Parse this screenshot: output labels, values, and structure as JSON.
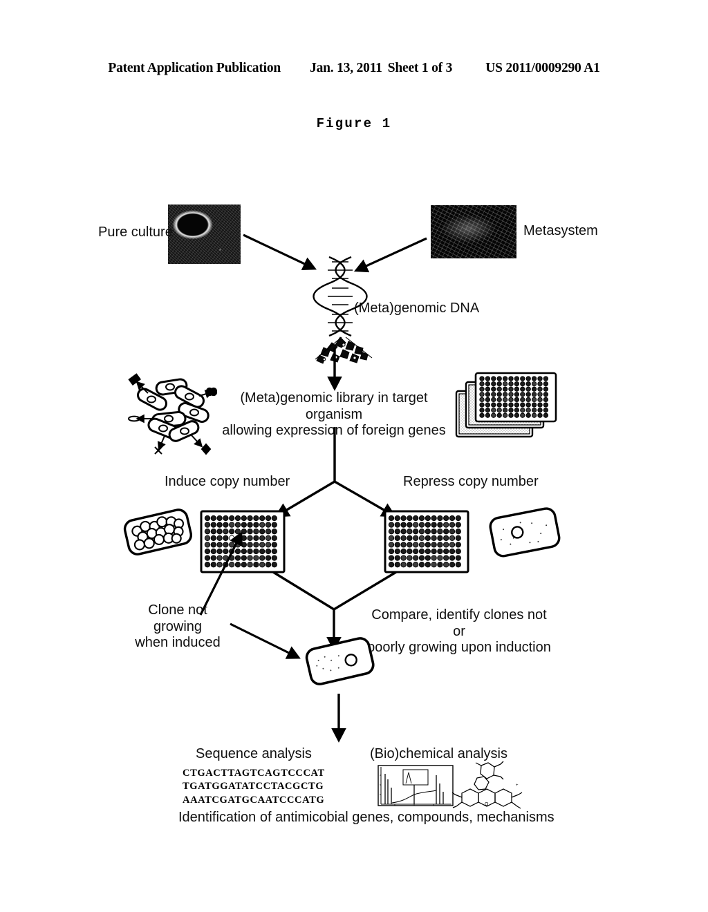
{
  "header": {
    "publication": "Patent Application Publication",
    "date": "Jan. 13, 2011",
    "sheet": "Sheet 1 of 3",
    "patent_number": "US 2011/0009290 A1"
  },
  "figure": {
    "caption": "Figure 1"
  },
  "diagram": {
    "pure_culture_label": "Pure culture",
    "metasystem_label": "Metasystem",
    "genomic_dna_label": "(Meta)genomic DNA",
    "library_label": "(Meta)genomic library in target organism\nallowing expression of foreign genes",
    "induce_label": "Induce copy number",
    "repress_label": "Repress copy number",
    "clone_not_growing_label": "Clone not growing\nwhen induced",
    "compare_label": "Compare, identify clones not or\npoorly growing upon induction",
    "sequence_analysis_label": "Sequence analysis",
    "biochemical_analysis_label": "(Bio)chemical analysis",
    "identification_label": "Identification of antimicobial genes, compounds, mechanisms",
    "dna_sequences": "CTGACTTAGTCAGTCCCAT\nTGATGGATATCCTACGCTG\nAAATCGATGCAATCCCATG"
  },
  "colors": {
    "ink": "#000000",
    "paper": "#ffffff",
    "photo_dark": "#0b0b0b"
  }
}
